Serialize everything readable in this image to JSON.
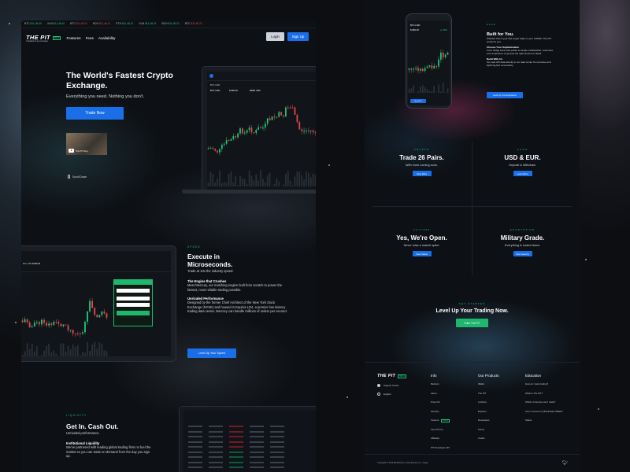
{
  "ticker": [
    {
      "sym": "BTC",
      "price": "$11,48.40",
      "dir": "up"
    },
    {
      "sym": "XLM",
      "price": "$11,48.40",
      "dir": "up"
    },
    {
      "sym": "BTC",
      "price": "$11,48.21",
      "dir": "dn"
    },
    {
      "sym": "BCH",
      "price": "$11,48.21",
      "dir": "dn"
    },
    {
      "sym": "ETH",
      "price": "$11,48.21",
      "dir": "up"
    },
    {
      "sym": "XLM",
      "price": "$11,48.21",
      "dir": "up"
    },
    {
      "sym": "BCH",
      "price": "$11,48.21",
      "dir": "up"
    },
    {
      "sym": "BTC",
      "price": "$11,48.21",
      "dir": "dn"
    }
  ],
  "nav": {
    "logo": "THE PIT",
    "logo_sub": "POWERED BY BLOCKCHAIN",
    "beta": "BETA",
    "links": [
      "Features",
      "Fees",
      "Availability"
    ],
    "login": "Login",
    "signup": "Sign Up"
  },
  "hero": {
    "title": "The World's Fastest Crypto Exchange.",
    "subtitle": "Everything you need. Nothing you don't.",
    "cta": "Trade Now",
    "video_label": "The PIT Story",
    "scroll": "Scroll Down"
  },
  "chart_top": {
    "pair": "BTC USD",
    "price": "8,960.00",
    "vol": "380M USD"
  },
  "speed": {
    "kicker": "SPEED",
    "title": "Execute in Microseconds.",
    "subtitle": "Trade at 10x the industry speed.",
    "h1": "The Engine that Crushes",
    "p1": "Meet Mercury, our matching engine built from scratch to power the fastest, most reliable trading possible.",
    "h2": "Unrivaled Performance",
    "p2": "Designed by the former Chief Architect of the New York Stock Exchange (NYSE) and housed in Equinix LD4, a premier low latency trading data center, Mercury can handle millions of orders per second.",
    "cta": "Level Up Your Speed"
  },
  "liquidity": {
    "kicker": "LIQUIDITY",
    "title": "Get In. Cash Out.",
    "subtitle": "Unrivaled performance.",
    "h1": "Institutional Liquidity",
    "p1": "We've partnered with leading global trading firms to fuel the market so you can trade on-demand from the day you sign up."
  },
  "built": {
    "kicker": "EASE",
    "title": "Built for You.",
    "p1": "Whether this is your first crypto trade or your 3,000th, The PIT works for you.",
    "h2": "Choose Your Sophistication",
    "p2": "From hedge fund chart packs to simple candlesticks, customize your experience to get just the right amount of detail.",
    "h3": "Build With Us",
    "p3": "Our web API data directly to our data center for exclusive and lightning-fast connectivity.",
    "cta": "Level Up Your Experience",
    "phone_pair": "BTC-USD",
    "phone_price": "8,960.00",
    "phone_change": "+1.26%",
    "phone_btn": "Buy BTC"
  },
  "features": [
    {
      "kicker": "CRYPTO",
      "title": "Trade 26 Pairs.",
      "sub": "With more coming soon.",
      "cta": "View Pairs"
    },
    {
      "kicker": "CASH",
      "title": "USD & EUR.",
      "sub": "Deposit & Withdraw.",
      "cta": "Learn More"
    },
    {
      "kicker": "24/7/365",
      "title": "Yes, We're Open.",
      "sub": "Never miss a market spike.",
      "cta": "View Status"
    },
    {
      "kicker": "ENCRYPTION",
      "title": "Military Grade.",
      "sub": "Everything is locked down.",
      "cta": "View Security"
    }
  ],
  "getstarted": {
    "kicker": "GET STARTED",
    "title": "Level Up Your Trading Now.",
    "cta": "Enter The PIT"
  },
  "footer": {
    "logo": "THE PIT",
    "beta": "BETA",
    "support": "Support Center",
    "lang": "English",
    "info": {
      "title": "Info",
      "items": [
        "Markets",
        "About",
        "Press Kit",
        "Security",
        "Careers",
        "The PIT Pro",
        "Affiliates",
        "PIT Developer API"
      ],
      "careers_badge": "HIRING"
    },
    "products": {
      "title": "Our Products",
      "items": [
        "Wallet",
        "The PIT",
        "Lockbox",
        "Explorer",
        "Developers",
        "Prices",
        "Charts"
      ]
    },
    "education": {
      "title": "Education",
      "items": [
        "How do I start trading?",
        "What is The PIT?",
        "Which currencies can I trade?",
        "Can I connect my Blockchain Wallet?",
        "Status"
      ]
    },
    "copyright": "Copyright © 2019 Blockchain  |  Luxembourg S.A.  |  Legal"
  },
  "colors": {
    "accent": "#1a6fe8",
    "green": "#21c77a",
    "red": "#e5484d",
    "bg": "#0c0e12"
  }
}
